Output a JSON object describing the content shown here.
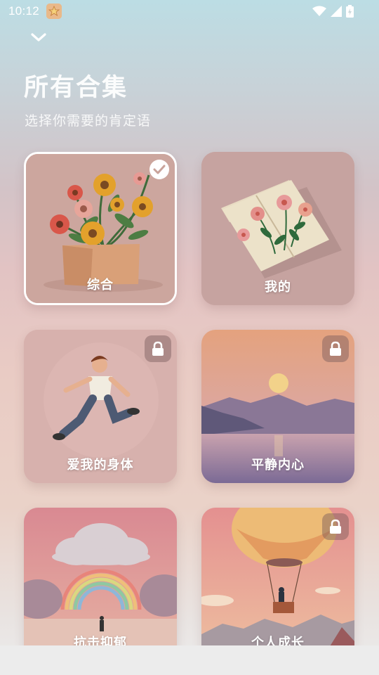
{
  "status": {
    "time": "10:12"
  },
  "header": {
    "title": "所有合集",
    "subtitle": "选择你需要的肯定语"
  },
  "collections": [
    {
      "label": "综合",
      "state": "selected",
      "art": "flower-pot"
    },
    {
      "label": "我的",
      "state": "unlocked",
      "art": "open-book-flowers"
    },
    {
      "label": "爱我的身体",
      "state": "locked",
      "art": "jumping-man"
    },
    {
      "label": "平静内心",
      "state": "locked",
      "art": "sunset-lake"
    },
    {
      "label": "抗击抑郁",
      "state": "unlocked",
      "art": "rainbow-cloud"
    },
    {
      "label": "个人成长",
      "state": "locked",
      "art": "hot-air-balloon"
    }
  ]
}
